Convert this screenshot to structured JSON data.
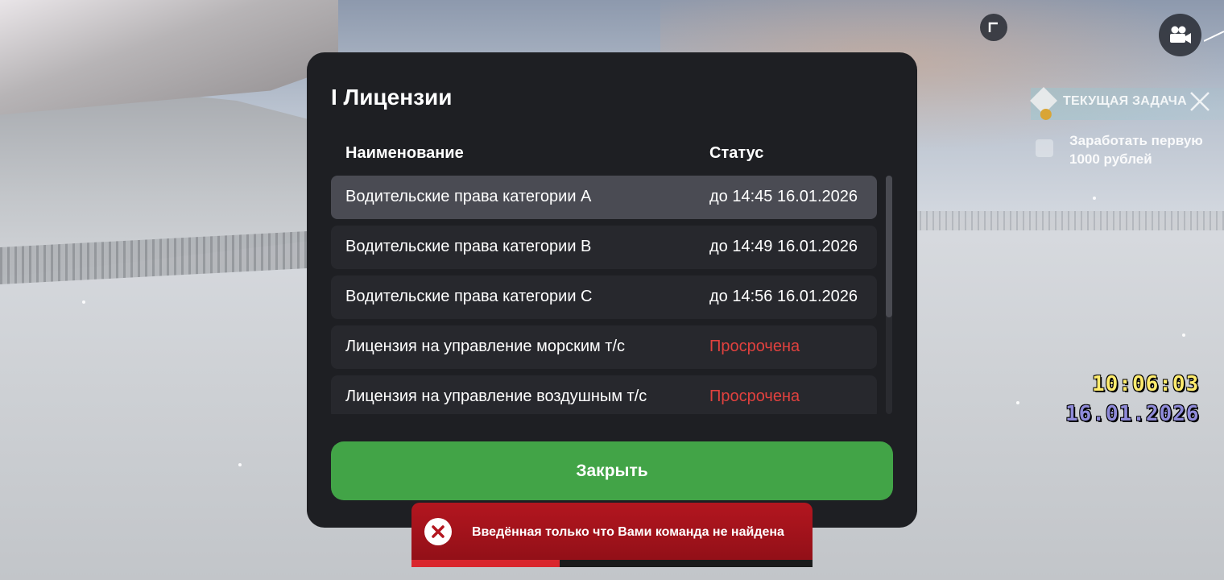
{
  "modal": {
    "title": "I Лицензии",
    "columns": {
      "name": "Наименование",
      "status": "Статус"
    },
    "rows": [
      {
        "name": "Водительские права категории A",
        "status": "до 14:45 16.01.2026",
        "expired": false,
        "selected": true
      },
      {
        "name": "Водительские права категории B",
        "status": "до 14:49 16.01.2026",
        "expired": false,
        "selected": false
      },
      {
        "name": "Водительские права категории C",
        "status": "до 14:56 16.01.2026",
        "expired": false,
        "selected": false
      },
      {
        "name": "Лицензия на управление морским т/с",
        "status": "Просрочена",
        "expired": true,
        "selected": false
      },
      {
        "name": "Лицензия на управление воздушным т/с",
        "status": "Просрочена",
        "expired": true,
        "selected": false
      }
    ],
    "close_label": "Закрыть"
  },
  "task": {
    "title": "ТЕКУЩАЯ ЗАДАЧА",
    "text": "Заработать первую 1000 рублей"
  },
  "hud": {
    "time": "10:06:03",
    "date": "16.01.2026",
    "icons": [
      "corner-icon",
      "camera-icon"
    ]
  },
  "toast": {
    "message": "Введённая только что Вами команда не найдена",
    "progress_fraction": 0.37
  },
  "colors": {
    "modal_bg": "#1e1f23",
    "row_bg": "#27282d",
    "row_selected": "#4a4b53",
    "expired": "#e0413e",
    "close_button": "#42a447",
    "toast": "#b3161f",
    "clock_time": "#ffec6e",
    "clock_date": "#8f8bd9"
  }
}
